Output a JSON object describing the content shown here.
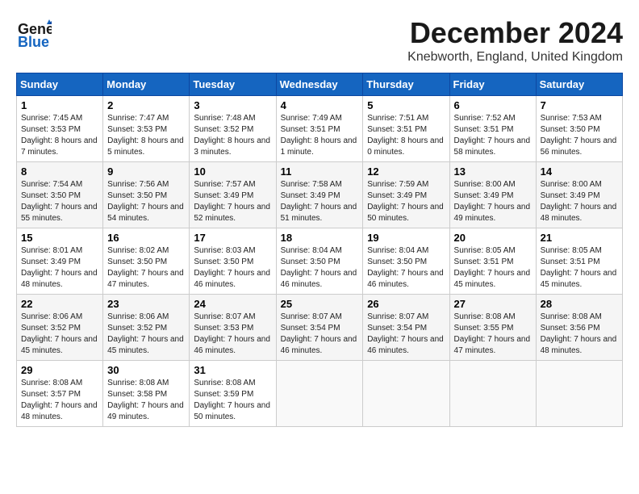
{
  "header": {
    "logo_line1": "General",
    "logo_line2": "Blue",
    "title": "December 2024",
    "location": "Knebworth, England, United Kingdom"
  },
  "days_of_week": [
    "Sunday",
    "Monday",
    "Tuesday",
    "Wednesday",
    "Thursday",
    "Friday",
    "Saturday"
  ],
  "weeks": [
    [
      {
        "day": 1,
        "sunrise": "Sunrise: 7:45 AM",
        "sunset": "Sunset: 3:53 PM",
        "daylight": "Daylight: 8 hours and 7 minutes."
      },
      {
        "day": 2,
        "sunrise": "Sunrise: 7:47 AM",
        "sunset": "Sunset: 3:53 PM",
        "daylight": "Daylight: 8 hours and 5 minutes."
      },
      {
        "day": 3,
        "sunrise": "Sunrise: 7:48 AM",
        "sunset": "Sunset: 3:52 PM",
        "daylight": "Daylight: 8 hours and 3 minutes."
      },
      {
        "day": 4,
        "sunrise": "Sunrise: 7:49 AM",
        "sunset": "Sunset: 3:51 PM",
        "daylight": "Daylight: 8 hours and 1 minute."
      },
      {
        "day": 5,
        "sunrise": "Sunrise: 7:51 AM",
        "sunset": "Sunset: 3:51 PM",
        "daylight": "Daylight: 8 hours and 0 minutes."
      },
      {
        "day": 6,
        "sunrise": "Sunrise: 7:52 AM",
        "sunset": "Sunset: 3:51 PM",
        "daylight": "Daylight: 7 hours and 58 minutes."
      },
      {
        "day": 7,
        "sunrise": "Sunrise: 7:53 AM",
        "sunset": "Sunset: 3:50 PM",
        "daylight": "Daylight: 7 hours and 56 minutes."
      }
    ],
    [
      {
        "day": 8,
        "sunrise": "Sunrise: 7:54 AM",
        "sunset": "Sunset: 3:50 PM",
        "daylight": "Daylight: 7 hours and 55 minutes."
      },
      {
        "day": 9,
        "sunrise": "Sunrise: 7:56 AM",
        "sunset": "Sunset: 3:50 PM",
        "daylight": "Daylight: 7 hours and 54 minutes."
      },
      {
        "day": 10,
        "sunrise": "Sunrise: 7:57 AM",
        "sunset": "Sunset: 3:49 PM",
        "daylight": "Daylight: 7 hours and 52 minutes."
      },
      {
        "day": 11,
        "sunrise": "Sunrise: 7:58 AM",
        "sunset": "Sunset: 3:49 PM",
        "daylight": "Daylight: 7 hours and 51 minutes."
      },
      {
        "day": 12,
        "sunrise": "Sunrise: 7:59 AM",
        "sunset": "Sunset: 3:49 PM",
        "daylight": "Daylight: 7 hours and 50 minutes."
      },
      {
        "day": 13,
        "sunrise": "Sunrise: 8:00 AM",
        "sunset": "Sunset: 3:49 PM",
        "daylight": "Daylight: 7 hours and 49 minutes."
      },
      {
        "day": 14,
        "sunrise": "Sunrise: 8:00 AM",
        "sunset": "Sunset: 3:49 PM",
        "daylight": "Daylight: 7 hours and 48 minutes."
      }
    ],
    [
      {
        "day": 15,
        "sunrise": "Sunrise: 8:01 AM",
        "sunset": "Sunset: 3:49 PM",
        "daylight": "Daylight: 7 hours and 48 minutes."
      },
      {
        "day": 16,
        "sunrise": "Sunrise: 8:02 AM",
        "sunset": "Sunset: 3:50 PM",
        "daylight": "Daylight: 7 hours and 47 minutes."
      },
      {
        "day": 17,
        "sunrise": "Sunrise: 8:03 AM",
        "sunset": "Sunset: 3:50 PM",
        "daylight": "Daylight: 7 hours and 46 minutes."
      },
      {
        "day": 18,
        "sunrise": "Sunrise: 8:04 AM",
        "sunset": "Sunset: 3:50 PM",
        "daylight": "Daylight: 7 hours and 46 minutes."
      },
      {
        "day": 19,
        "sunrise": "Sunrise: 8:04 AM",
        "sunset": "Sunset: 3:50 PM",
        "daylight": "Daylight: 7 hours and 46 minutes."
      },
      {
        "day": 20,
        "sunrise": "Sunrise: 8:05 AM",
        "sunset": "Sunset: 3:51 PM",
        "daylight": "Daylight: 7 hours and 45 minutes."
      },
      {
        "day": 21,
        "sunrise": "Sunrise: 8:05 AM",
        "sunset": "Sunset: 3:51 PM",
        "daylight": "Daylight: 7 hours and 45 minutes."
      }
    ],
    [
      {
        "day": 22,
        "sunrise": "Sunrise: 8:06 AM",
        "sunset": "Sunset: 3:52 PM",
        "daylight": "Daylight: 7 hours and 45 minutes."
      },
      {
        "day": 23,
        "sunrise": "Sunrise: 8:06 AM",
        "sunset": "Sunset: 3:52 PM",
        "daylight": "Daylight: 7 hours and 45 minutes."
      },
      {
        "day": 24,
        "sunrise": "Sunrise: 8:07 AM",
        "sunset": "Sunset: 3:53 PM",
        "daylight": "Daylight: 7 hours and 46 minutes."
      },
      {
        "day": 25,
        "sunrise": "Sunrise: 8:07 AM",
        "sunset": "Sunset: 3:54 PM",
        "daylight": "Daylight: 7 hours and 46 minutes."
      },
      {
        "day": 26,
        "sunrise": "Sunrise: 8:07 AM",
        "sunset": "Sunset: 3:54 PM",
        "daylight": "Daylight: 7 hours and 46 minutes."
      },
      {
        "day": 27,
        "sunrise": "Sunrise: 8:08 AM",
        "sunset": "Sunset: 3:55 PM",
        "daylight": "Daylight: 7 hours and 47 minutes."
      },
      {
        "day": 28,
        "sunrise": "Sunrise: 8:08 AM",
        "sunset": "Sunset: 3:56 PM",
        "daylight": "Daylight: 7 hours and 48 minutes."
      }
    ],
    [
      {
        "day": 29,
        "sunrise": "Sunrise: 8:08 AM",
        "sunset": "Sunset: 3:57 PM",
        "daylight": "Daylight: 7 hours and 48 minutes."
      },
      {
        "day": 30,
        "sunrise": "Sunrise: 8:08 AM",
        "sunset": "Sunset: 3:58 PM",
        "daylight": "Daylight: 7 hours and 49 minutes."
      },
      {
        "day": 31,
        "sunrise": "Sunrise: 8:08 AM",
        "sunset": "Sunset: 3:59 PM",
        "daylight": "Daylight: 7 hours and 50 minutes."
      },
      null,
      null,
      null,
      null
    ]
  ]
}
